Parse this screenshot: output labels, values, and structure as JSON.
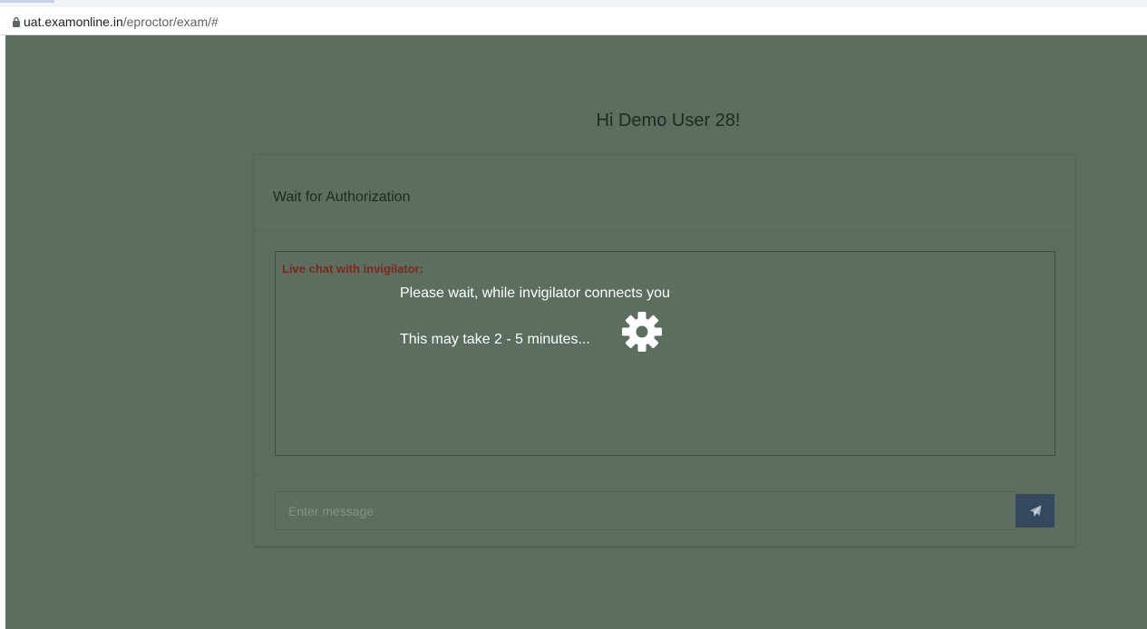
{
  "browser": {
    "url_host": "uat.examonline.in",
    "url_path": "/eproctor/exam/#",
    "lock_icon": "lock-icon"
  },
  "page": {
    "greeting": "Hi Demo User 28!",
    "panel_title": "Wait for Authorization",
    "chat": {
      "label": "Live chat with invigilator:",
      "wait_message": "Please wait, while invigilator connects you",
      "duration_message": "This may take 2 - 5 minutes...",
      "loading_icon": "gear-icon"
    },
    "message_input": {
      "placeholder": "Enter message",
      "value": ""
    },
    "send_button": {
      "icon": "send-icon"
    }
  },
  "colors": {
    "overlay": "#5b6e60",
    "chat_label": "#7a2a1d",
    "send_button": "#34495e"
  }
}
